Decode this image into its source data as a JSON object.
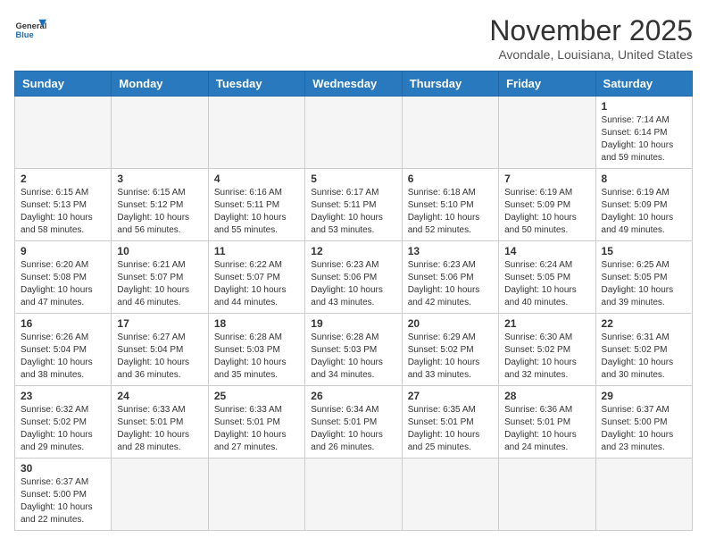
{
  "header": {
    "logo_general": "General",
    "logo_blue": "Blue",
    "month_title": "November 2025",
    "location": "Avondale, Louisiana, United States"
  },
  "days_of_week": [
    "Sunday",
    "Monday",
    "Tuesday",
    "Wednesday",
    "Thursday",
    "Friday",
    "Saturday"
  ],
  "weeks": [
    [
      {
        "day": "",
        "info": ""
      },
      {
        "day": "",
        "info": ""
      },
      {
        "day": "",
        "info": ""
      },
      {
        "day": "",
        "info": ""
      },
      {
        "day": "",
        "info": ""
      },
      {
        "day": "",
        "info": ""
      },
      {
        "day": "1",
        "info": "Sunrise: 7:14 AM\nSunset: 6:14 PM\nDaylight: 10 hours and 59 minutes."
      }
    ],
    [
      {
        "day": "2",
        "info": "Sunrise: 6:15 AM\nSunset: 5:13 PM\nDaylight: 10 hours and 58 minutes."
      },
      {
        "day": "3",
        "info": "Sunrise: 6:15 AM\nSunset: 5:12 PM\nDaylight: 10 hours and 56 minutes."
      },
      {
        "day": "4",
        "info": "Sunrise: 6:16 AM\nSunset: 5:11 PM\nDaylight: 10 hours and 55 minutes."
      },
      {
        "day": "5",
        "info": "Sunrise: 6:17 AM\nSunset: 5:11 PM\nDaylight: 10 hours and 53 minutes."
      },
      {
        "day": "6",
        "info": "Sunrise: 6:18 AM\nSunset: 5:10 PM\nDaylight: 10 hours and 52 minutes."
      },
      {
        "day": "7",
        "info": "Sunrise: 6:19 AM\nSunset: 5:09 PM\nDaylight: 10 hours and 50 minutes."
      },
      {
        "day": "8",
        "info": "Sunrise: 6:19 AM\nSunset: 5:09 PM\nDaylight: 10 hours and 49 minutes."
      }
    ],
    [
      {
        "day": "9",
        "info": "Sunrise: 6:20 AM\nSunset: 5:08 PM\nDaylight: 10 hours and 47 minutes."
      },
      {
        "day": "10",
        "info": "Sunrise: 6:21 AM\nSunset: 5:07 PM\nDaylight: 10 hours and 46 minutes."
      },
      {
        "day": "11",
        "info": "Sunrise: 6:22 AM\nSunset: 5:07 PM\nDaylight: 10 hours and 44 minutes."
      },
      {
        "day": "12",
        "info": "Sunrise: 6:23 AM\nSunset: 5:06 PM\nDaylight: 10 hours and 43 minutes."
      },
      {
        "day": "13",
        "info": "Sunrise: 6:23 AM\nSunset: 5:06 PM\nDaylight: 10 hours and 42 minutes."
      },
      {
        "day": "14",
        "info": "Sunrise: 6:24 AM\nSunset: 5:05 PM\nDaylight: 10 hours and 40 minutes."
      },
      {
        "day": "15",
        "info": "Sunrise: 6:25 AM\nSunset: 5:05 PM\nDaylight: 10 hours and 39 minutes."
      }
    ],
    [
      {
        "day": "16",
        "info": "Sunrise: 6:26 AM\nSunset: 5:04 PM\nDaylight: 10 hours and 38 minutes."
      },
      {
        "day": "17",
        "info": "Sunrise: 6:27 AM\nSunset: 5:04 PM\nDaylight: 10 hours and 36 minutes."
      },
      {
        "day": "18",
        "info": "Sunrise: 6:28 AM\nSunset: 5:03 PM\nDaylight: 10 hours and 35 minutes."
      },
      {
        "day": "19",
        "info": "Sunrise: 6:28 AM\nSunset: 5:03 PM\nDaylight: 10 hours and 34 minutes."
      },
      {
        "day": "20",
        "info": "Sunrise: 6:29 AM\nSunset: 5:02 PM\nDaylight: 10 hours and 33 minutes."
      },
      {
        "day": "21",
        "info": "Sunrise: 6:30 AM\nSunset: 5:02 PM\nDaylight: 10 hours and 32 minutes."
      },
      {
        "day": "22",
        "info": "Sunrise: 6:31 AM\nSunset: 5:02 PM\nDaylight: 10 hours and 30 minutes."
      }
    ],
    [
      {
        "day": "23",
        "info": "Sunrise: 6:32 AM\nSunset: 5:02 PM\nDaylight: 10 hours and 29 minutes."
      },
      {
        "day": "24",
        "info": "Sunrise: 6:33 AM\nSunset: 5:01 PM\nDaylight: 10 hours and 28 minutes."
      },
      {
        "day": "25",
        "info": "Sunrise: 6:33 AM\nSunset: 5:01 PM\nDaylight: 10 hours and 27 minutes."
      },
      {
        "day": "26",
        "info": "Sunrise: 6:34 AM\nSunset: 5:01 PM\nDaylight: 10 hours and 26 minutes."
      },
      {
        "day": "27",
        "info": "Sunrise: 6:35 AM\nSunset: 5:01 PM\nDaylight: 10 hours and 25 minutes."
      },
      {
        "day": "28",
        "info": "Sunrise: 6:36 AM\nSunset: 5:01 PM\nDaylight: 10 hours and 24 minutes."
      },
      {
        "day": "29",
        "info": "Sunrise: 6:37 AM\nSunset: 5:00 PM\nDaylight: 10 hours and 23 minutes."
      }
    ],
    [
      {
        "day": "30",
        "info": "Sunrise: 6:37 AM\nSunset: 5:00 PM\nDaylight: 10 hours and 22 minutes."
      },
      {
        "day": "",
        "info": ""
      },
      {
        "day": "",
        "info": ""
      },
      {
        "day": "",
        "info": ""
      },
      {
        "day": "",
        "info": ""
      },
      {
        "day": "",
        "info": ""
      },
      {
        "day": "",
        "info": ""
      }
    ]
  ]
}
